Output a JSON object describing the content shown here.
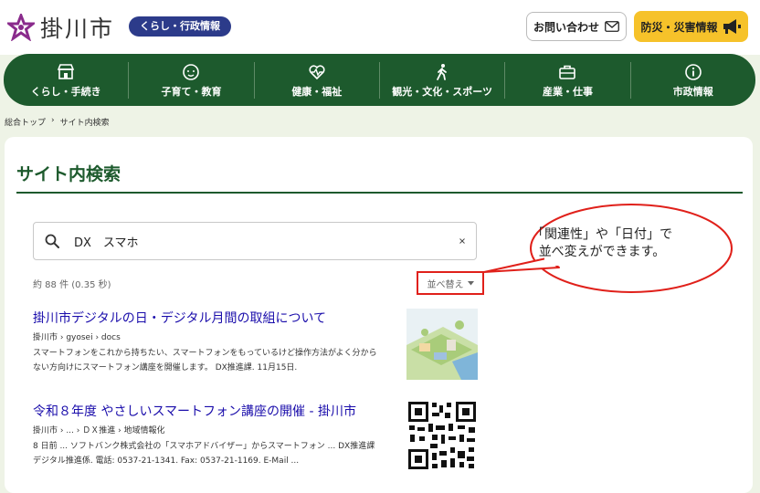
{
  "header": {
    "site_name": "掛川市",
    "pill_label": "くらし・行政情報",
    "contact_label": "お問い合わせ",
    "disaster_label": "防災・災害情報"
  },
  "nav": [
    {
      "label": "くらし・手続き",
      "icon": "shop-icon"
    },
    {
      "label": "子育て・教育",
      "icon": "child-face-icon"
    },
    {
      "label": "健康・福祉",
      "icon": "heart-pulse-icon"
    },
    {
      "label": "観光・文化・スポーツ",
      "icon": "walking-person-icon"
    },
    {
      "label": "産業・仕事",
      "icon": "briefcase-icon"
    },
    {
      "label": "市政情報",
      "icon": "info-icon"
    }
  ],
  "breadcrumb": {
    "home": "総合トップ",
    "sep": "›",
    "current": "サイト内検索"
  },
  "page_title": "サイト内検索",
  "search": {
    "value": "DX　スマホ"
  },
  "result_count": "約 88 件 (0.35 秒)",
  "sort_label": "並べ替え",
  "results": [
    {
      "title": "掛川市デジタルの日・デジタル月間の取組について",
      "url": "掛川市 › gyosei › docs",
      "snippet": "スマートフォンをこれから持ちたい、スマートフォンをもっているけど操作方法がよく分からない方向けにスマートフォン講座を開催します。 DX推進課. 11月15日."
    },
    {
      "title": "令和８年度 やさしいスマートフォン講座の開催 - 掛川市",
      "url": "掛川市 › ... › ＤＸ推進 › 地域情報化",
      "snippet": "8 日前 ... ソフトバンク株式会社の「スマホアドバイザー」からスマートフォン ... DX推進課 デジタル推進係. 電話: 0537-21-1341. Fax: 0537-21-1169. E-Mail ..."
    }
  ],
  "callout": {
    "line1": "「関連性」や「日付」で",
    "line2": "並べ変えができます。"
  },
  "colors": {
    "brand_green": "#1d5a2d",
    "pill_navy": "#2c3b8a",
    "disaster_yellow": "#f6c22a",
    "link": "#1a0dab",
    "highlight_red": "#e0201a"
  }
}
